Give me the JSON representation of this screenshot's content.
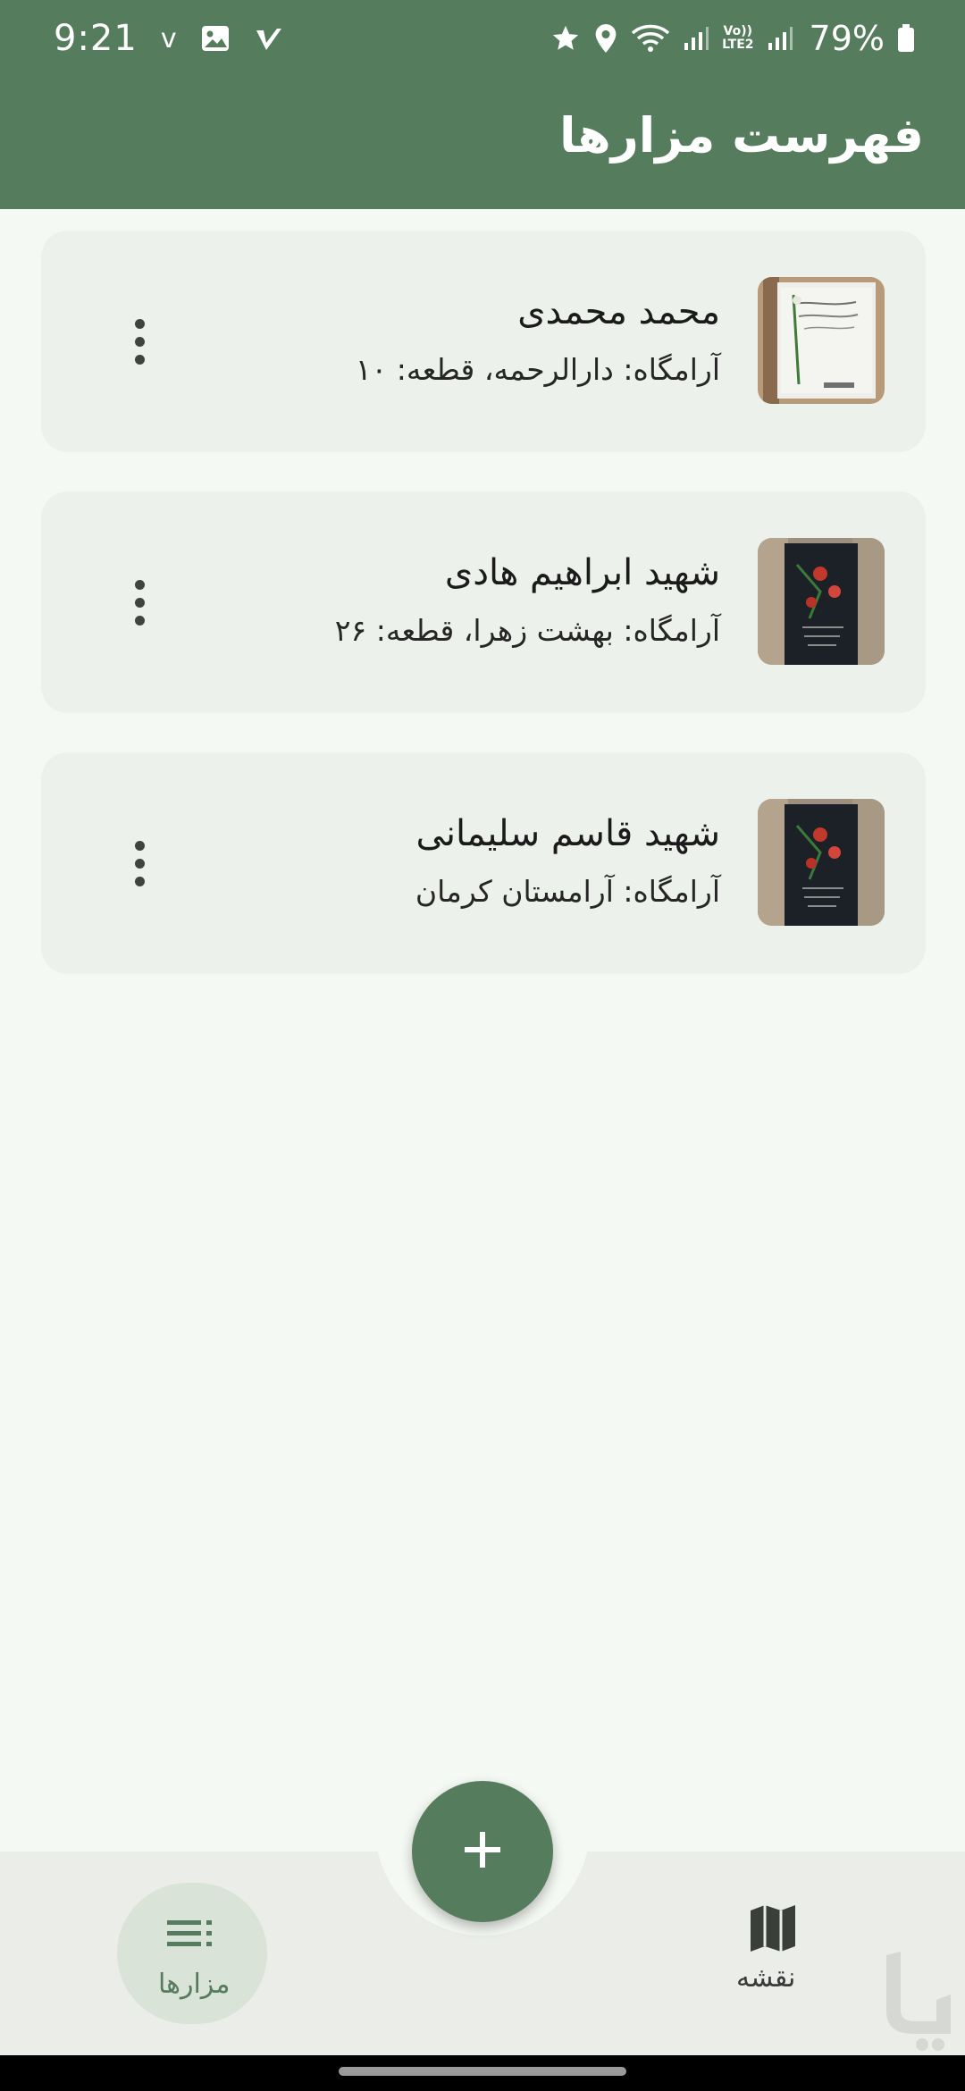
{
  "status_bar": {
    "time": "9:21",
    "notification_glyph": "v",
    "battery_percent": "79%",
    "lte_top": "Vo))",
    "lte_bottom": "LTE2"
  },
  "header": {
    "title": "فهرست مزارها"
  },
  "graves": [
    {
      "name": "محمد محمدی",
      "location": "آرامگاه: دارالرحمه، قطعه: ۱۰"
    },
    {
      "name": "شهید ابراهیم هادی",
      "location": "آرامگاه: بهشت زهرا، قطعه: ۲۶"
    },
    {
      "name": "شهید قاسم سلیمانی",
      "location": "آرامگاه: آرامستان کرمان"
    }
  ],
  "bottom_nav": {
    "list_label": "مزارها",
    "map_label": "نقشه"
  },
  "colors": {
    "primary": "#557c5c",
    "background": "#f5f9f3",
    "card": "#edf1eb",
    "nav_active_pill": "#d9e3d7"
  }
}
